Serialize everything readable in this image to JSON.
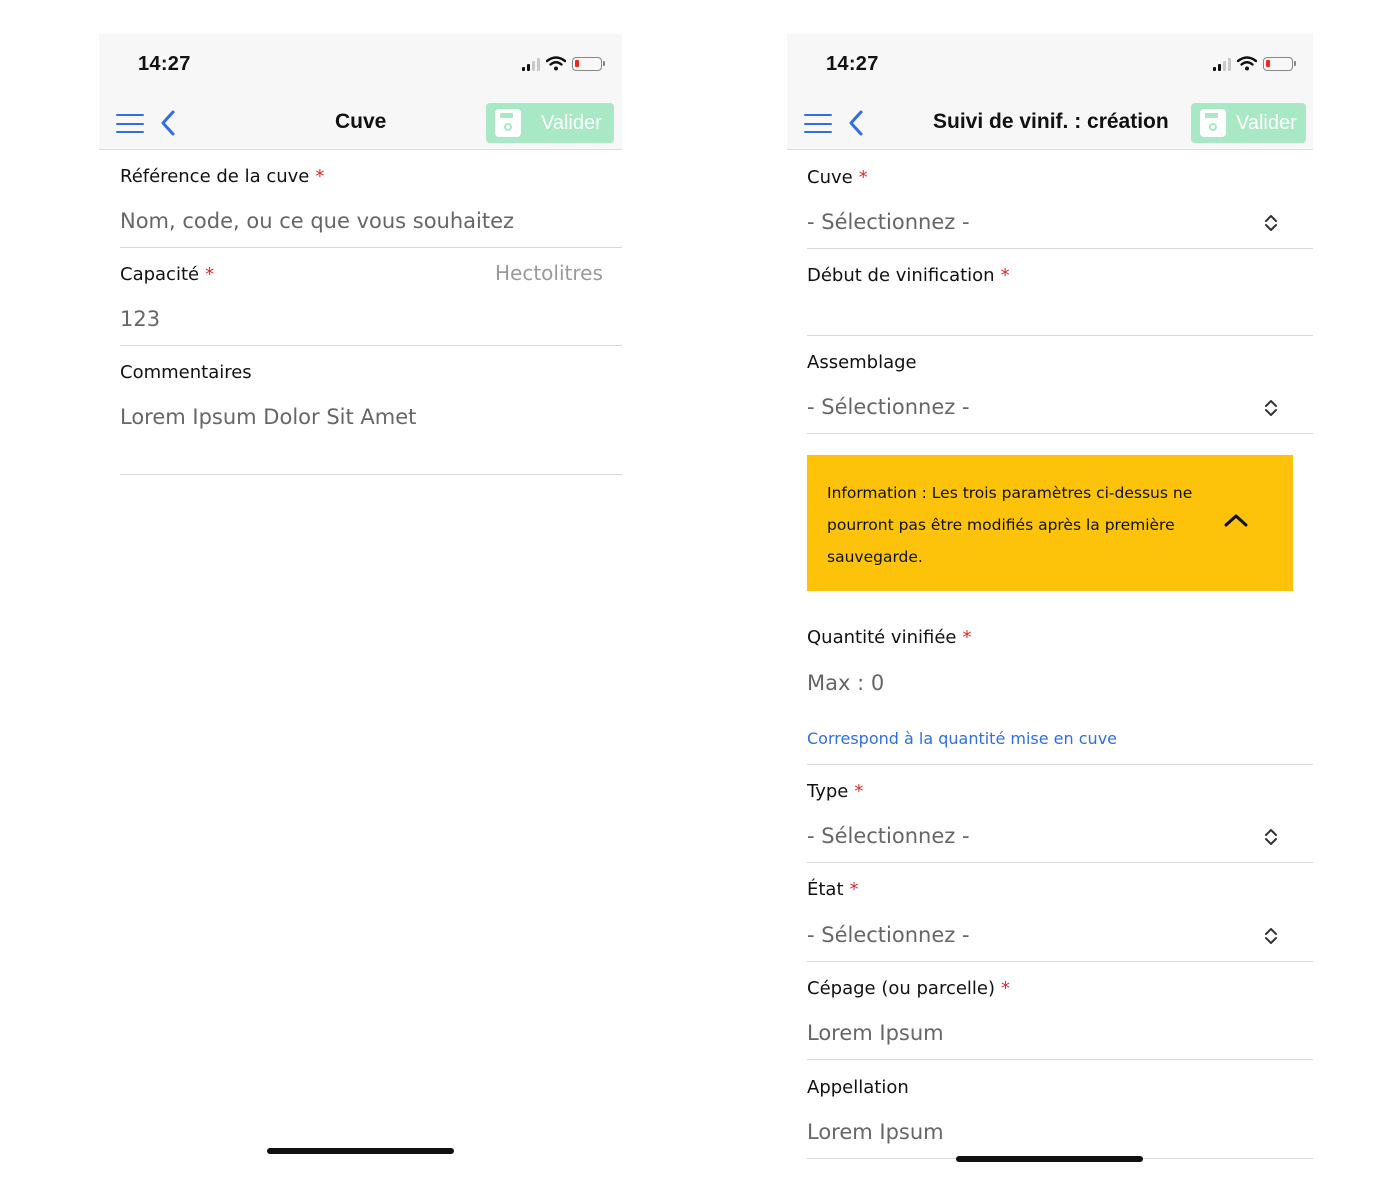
{
  "left_screen": {
    "status_bar": {
      "time": "14:27"
    },
    "nav": {
      "title": "Cuve",
      "valider_label": "Valider"
    },
    "fields": {
      "reference": {
        "label": "Référence de la cuve",
        "required_mark": "*",
        "placeholder": "Nom, code, ou ce que vous souhaitez"
      },
      "capacite": {
        "label": "Capacité",
        "required_mark": "*",
        "unit": "Hectolitres",
        "value": "123"
      },
      "commentaires": {
        "label": "Commentaires",
        "value": "Lorem Ipsum Dolor Sit Amet"
      }
    }
  },
  "right_screen": {
    "status_bar": {
      "time": "14:27"
    },
    "nav": {
      "title": "Suivi de vinif. : création",
      "valider_label": "Valider"
    },
    "fields": {
      "cuve": {
        "label": "Cuve",
        "required_mark": "*",
        "value": "- Sélectionnez -"
      },
      "debut": {
        "label": "Début de vinification",
        "required_mark": "*"
      },
      "assemblage": {
        "label": "Assemblage",
        "value": "- Sélectionnez -"
      },
      "info": {
        "text": "Information : Les trois paramètres ci-dessus ne pourront pas être modifiés après la première sauvegarde."
      },
      "quantite": {
        "label": "Quantité vinifiée",
        "required_mark": "*",
        "placeholder": "Max : 0",
        "hint": "Correspond à la quantité mise en cuve"
      },
      "type": {
        "label": "Type",
        "required_mark": "*",
        "value": "- Sélectionnez -"
      },
      "etat": {
        "label": "État",
        "required_mark": "*",
        "value": "- Sélectionnez -"
      },
      "cepage": {
        "label": "Cépage (ou parcelle)",
        "required_mark": "*",
        "value": "Lorem Ipsum"
      },
      "appellation": {
        "label": "Appellation",
        "value": "Lorem Ipsum"
      }
    }
  },
  "colors": {
    "accent_blue": "#2f6fe0",
    "valider_green": "#a9e8c4",
    "info_yellow": "#fcc30a",
    "required_red": "#e0272b",
    "battery_red": "#ec2a1f"
  },
  "icons": {
    "menu": "hamburger-menu-icon",
    "back": "chevron-left-icon",
    "save": "floppy-disk-icon",
    "select": "up-down-chevron-icon",
    "collapse": "chevron-up-icon",
    "signal": "cellular-signal-icon",
    "wifi": "wifi-icon",
    "battery": "battery-low-icon"
  }
}
